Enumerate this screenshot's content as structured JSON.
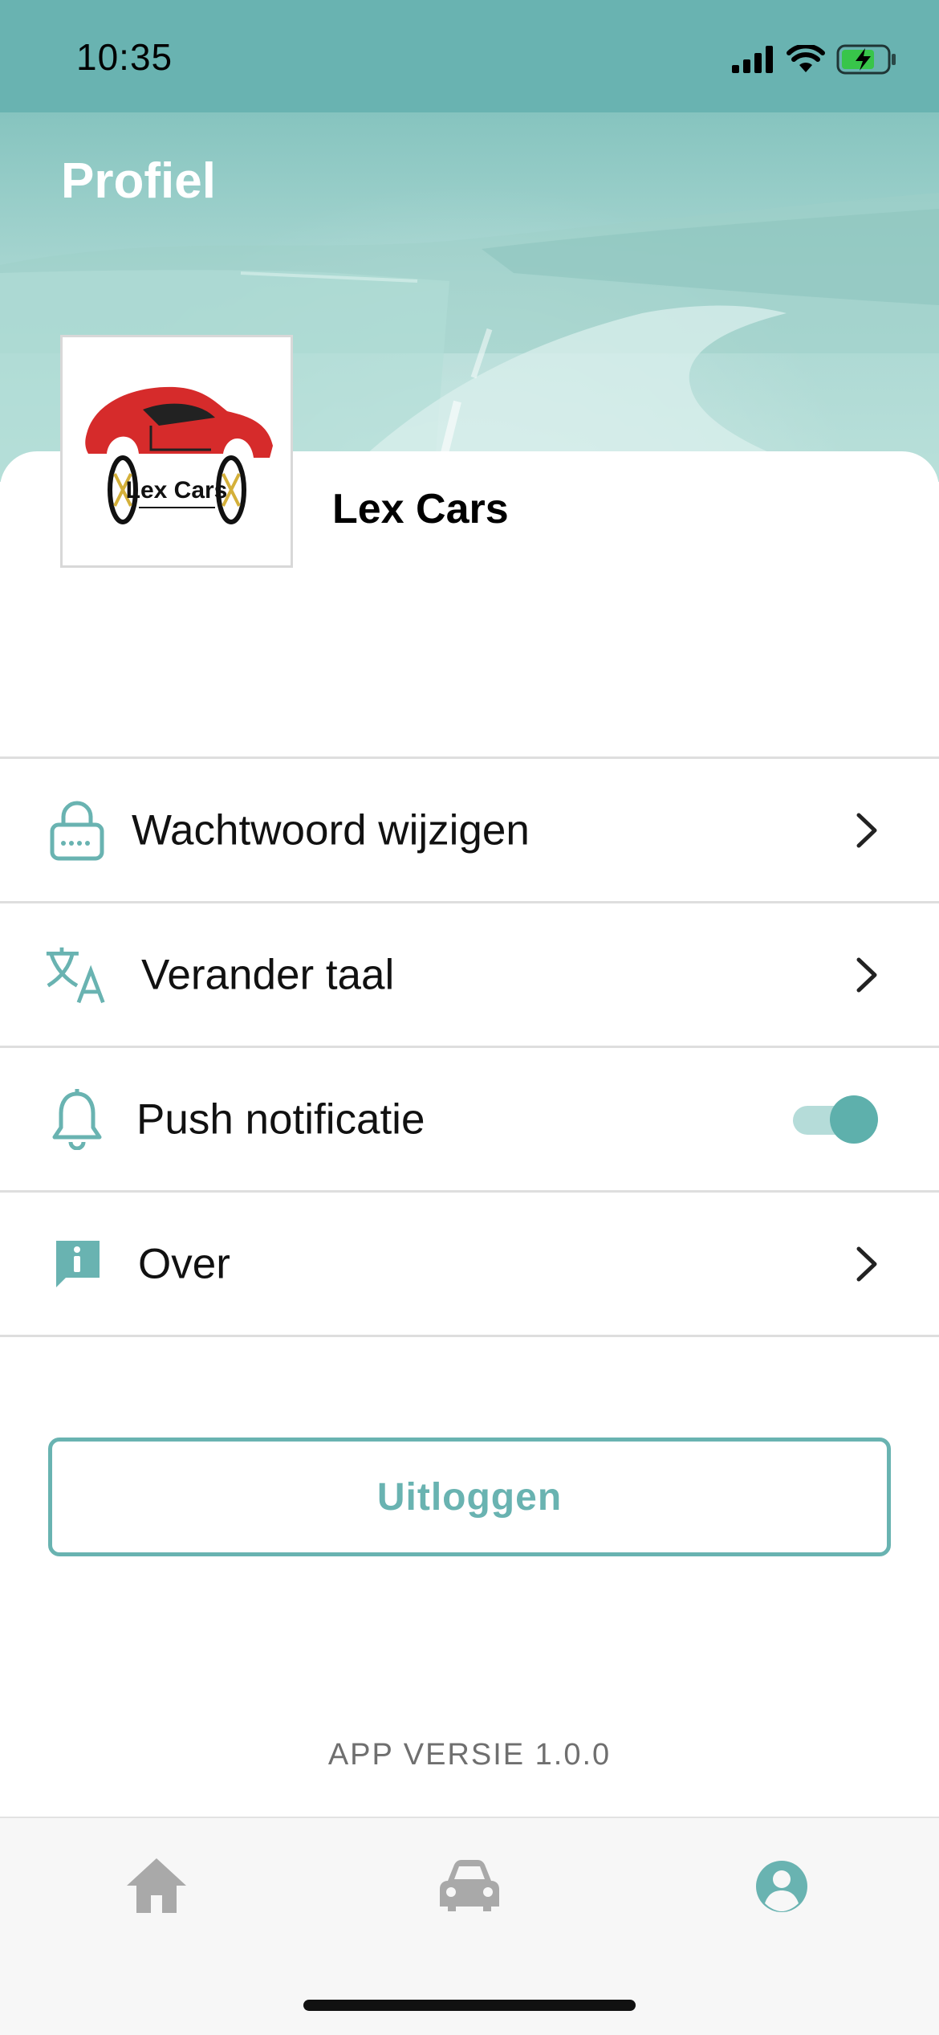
{
  "status_bar": {
    "time": "10:35"
  },
  "header": {
    "title": "Profiel"
  },
  "profile": {
    "name": "Lex Cars",
    "logo_text": "Lex Cars"
  },
  "menu": [
    {
      "label": "Wachtwoord wijzigen",
      "icon": "lock-icon"
    },
    {
      "label": "Verander taal",
      "icon": "translate-icon"
    },
    {
      "label": "Push notificatie",
      "icon": "bell-icon",
      "toggle_on": true
    },
    {
      "label": "Over",
      "icon": "info-icon"
    }
  ],
  "logout_label": "Uitloggen",
  "version_label": "APP VERSIE 1.0.0",
  "tabs": [
    {
      "icon": "home-icon",
      "active": false
    },
    {
      "icon": "car-icon",
      "active": false
    },
    {
      "icon": "profile-icon",
      "active": true
    }
  ],
  "colors": {
    "accent": "#69b3b1",
    "inactive_tab": "#a9a9a9"
  }
}
